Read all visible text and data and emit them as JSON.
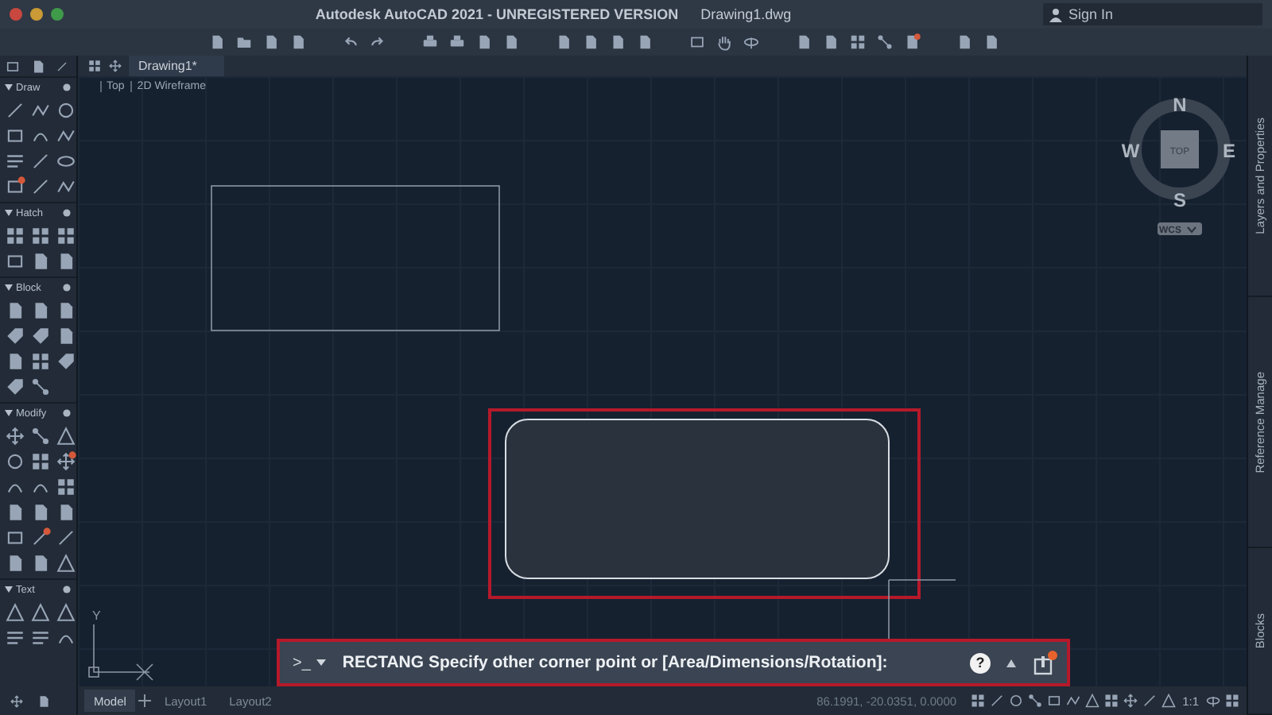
{
  "window": {
    "title": "Autodesk AutoCAD 2021 - UNREGISTERED VERSION",
    "document": "Drawing1.dwg",
    "account": "Sign In"
  },
  "tabs": [
    {
      "label": "Drawing1*",
      "selected": true
    }
  ],
  "palette": {
    "sections": [
      {
        "title": "Draw"
      },
      {
        "title": "Hatch"
      },
      {
        "title": "Block"
      },
      {
        "title": "Modify"
      },
      {
        "title": "Text"
      }
    ]
  },
  "viewport": {
    "controls": [
      "Top",
      "2D Wireframe"
    ]
  },
  "viewcube": {
    "north": "N",
    "east": "E",
    "south": "S",
    "west": "W",
    "face": "TOP",
    "ucs": "WCS"
  },
  "side_panels": [
    "Layers and Properties",
    "Reference Manage",
    "Blocks"
  ],
  "ucs_axis": "Y",
  "command_line": {
    "prompt_icon": ">_",
    "text": "RECTANG Specify other corner point or [Area/Dimensions/Rotation]:",
    "help": "?"
  },
  "layout_tabs": [
    {
      "label": "Model",
      "selected": true
    },
    {
      "label": "Layout1",
      "selected": false
    },
    {
      "label": "Layout2",
      "selected": false
    }
  ],
  "status_bar": {
    "coordinates": "86.1991, -20.0351, 0.0000",
    "scale": "1:1"
  }
}
